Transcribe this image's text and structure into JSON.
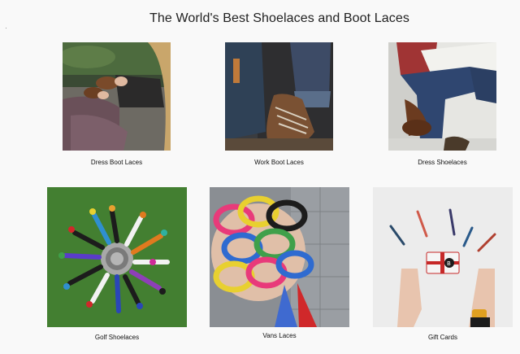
{
  "page": {
    "title": "The World's Best Shoelaces and Boot Laces"
  },
  "categories": [
    {
      "label": "Dress Boot Laces",
      "image_icon": "dress-boot-laces-photo"
    },
    {
      "label": "Work Boot Laces",
      "image_icon": "work-boot-laces-photo"
    },
    {
      "label": "Dress Shoelaces",
      "image_icon": "dress-shoelaces-photo"
    },
    {
      "label": "Golf Shoelaces",
      "image_icon": "golf-shoelaces-photo"
    },
    {
      "label": "Vans Laces",
      "image_icon": "vans-laces-photo"
    },
    {
      "label": "Gift Cards",
      "image_icon": "gift-cards-photo"
    }
  ],
  "colors": {
    "background": "#f9f9f9",
    "text": "#222222",
    "golf_grass": "#3f7a2f",
    "gift_card_red": "#c62828"
  }
}
